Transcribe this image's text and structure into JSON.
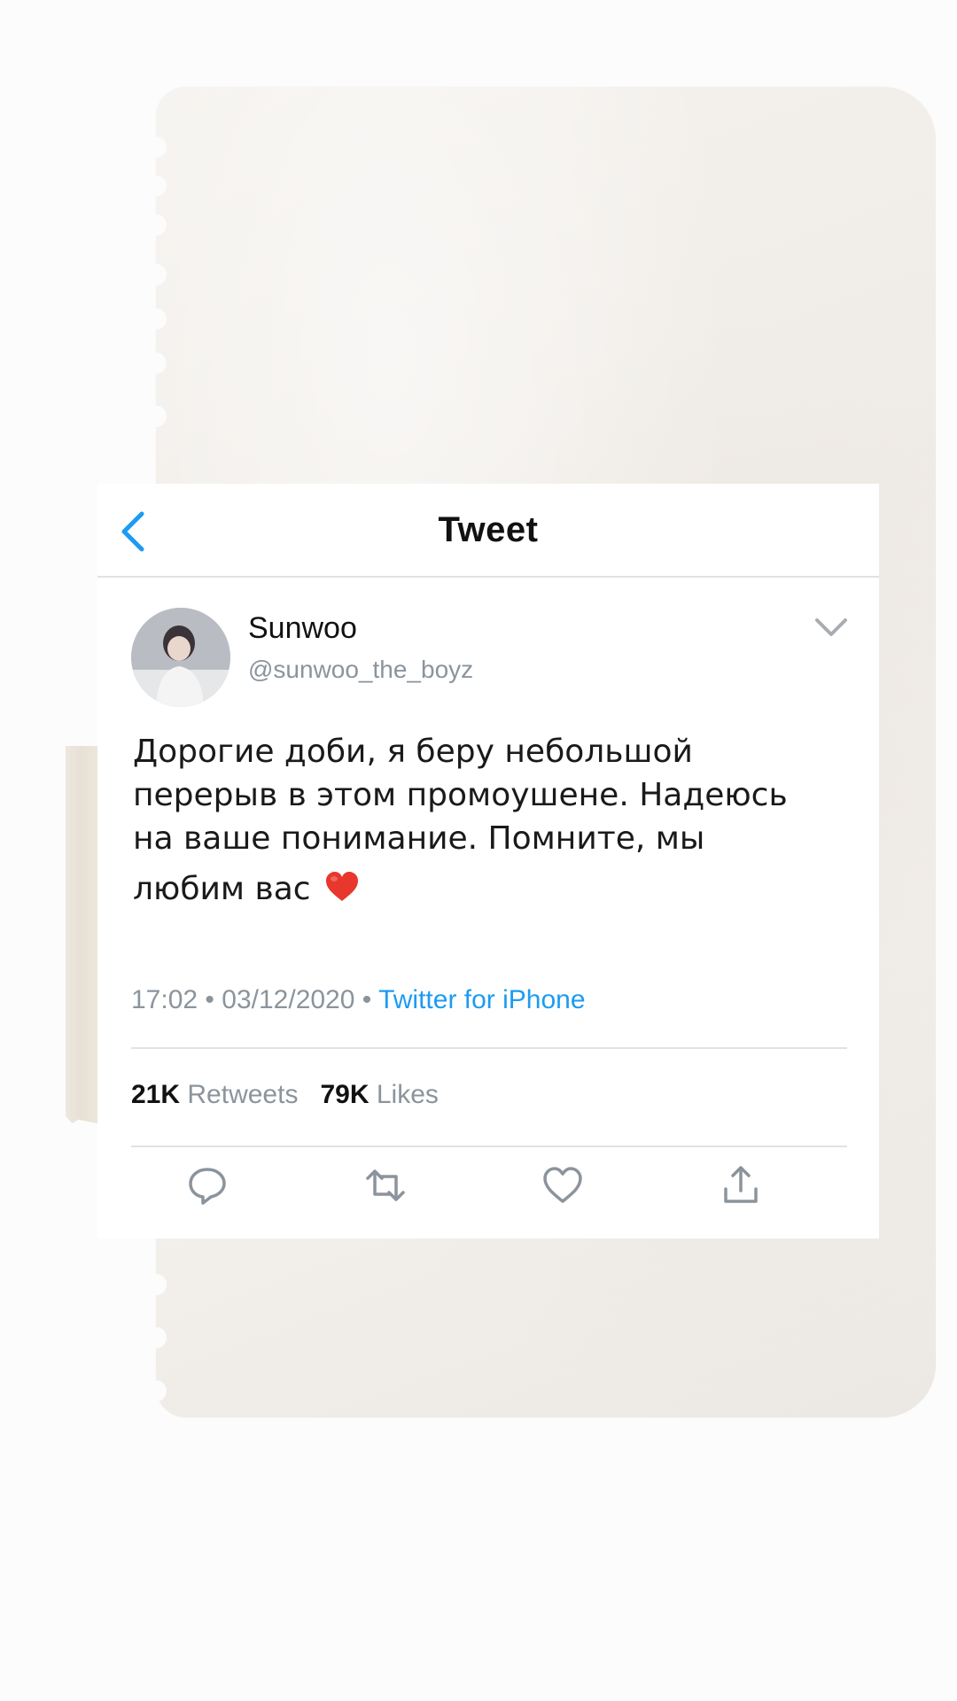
{
  "header": {
    "title": "Tweet",
    "back_icon": "chevron-left-icon"
  },
  "tweet": {
    "author": {
      "name": "Sunwoo",
      "handle": "@sunwoo_the_boyz"
    },
    "text_lines": [
      "Дорогие доби, я беру небольшой",
      "перерыв в этом промоушене. Надеюсь",
      "на ваше понимание. Помните, мы",
      "любим вас"
    ],
    "emoji": "red-heart-emoji",
    "time": "17:02",
    "date": "03/12/2020",
    "separator": "•",
    "source": "Twitter for iPhone",
    "retweets_count": "21K",
    "retweets_label": "Retweets",
    "likes_count": "79K",
    "likes_label": "Likes"
  },
  "actions": [
    {
      "icon": "reply-icon"
    },
    {
      "icon": "retweet-icon"
    },
    {
      "icon": "like-icon"
    },
    {
      "icon": "share-icon"
    }
  ],
  "colors": {
    "accent": "#1d9bf0",
    "secondary_text": "#8b949c",
    "paper": "#f1eee9"
  }
}
